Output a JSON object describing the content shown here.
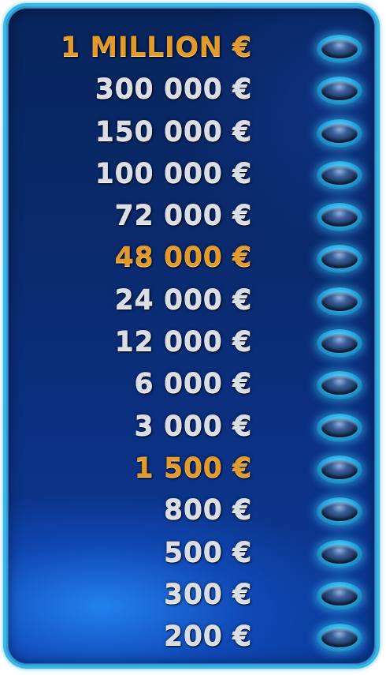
{
  "ladder": {
    "rungs": [
      {
        "amount": "1 MILLION €",
        "milestone": true,
        "lit": false
      },
      {
        "amount": "300 000 €",
        "milestone": false,
        "lit": false
      },
      {
        "amount": "150 000 €",
        "milestone": false,
        "lit": false
      },
      {
        "amount": "100 000 €",
        "milestone": false,
        "lit": false
      },
      {
        "amount": "72 000 €",
        "milestone": false,
        "lit": false
      },
      {
        "amount": "48 000 €",
        "milestone": true,
        "lit": false
      },
      {
        "amount": "24 000 €",
        "milestone": false,
        "lit": false
      },
      {
        "amount": "12 000 €",
        "milestone": false,
        "lit": false
      },
      {
        "amount": "6 000 €",
        "milestone": false,
        "lit": false
      },
      {
        "amount": "3 000 €",
        "milestone": false,
        "lit": false
      },
      {
        "amount": "1 500 €",
        "milestone": true,
        "lit": false
      },
      {
        "amount": "800 €",
        "milestone": false,
        "lit": false
      },
      {
        "amount": "500 €",
        "milestone": false,
        "lit": false
      },
      {
        "amount": "300 €",
        "milestone": false,
        "lit": false
      },
      {
        "amount": "200 €",
        "milestone": false,
        "lit": false
      }
    ]
  },
  "colors": {
    "regular_amount": "#d9dde6",
    "milestone_amount": "#e39a2c",
    "frame": "#36b8e6",
    "panel_background": "#0a2a6c"
  },
  "icons": {
    "rung_lamp": "oval-lamp-icon"
  }
}
